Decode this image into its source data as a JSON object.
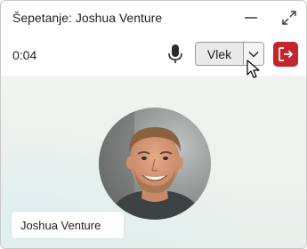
{
  "window": {
    "title": "Šepetanje: Joshua Venture"
  },
  "titlebar": {
    "minimize_icon": "minimize-icon",
    "expand_icon": "expand-icon"
  },
  "call": {
    "timer": "0:04",
    "mic_icon": "microphone-icon",
    "mode_button_label": "Vlek",
    "mode_dropdown_icon": "chevron-down-icon",
    "leave_icon": "leave-call-icon",
    "leave_color": "#c4262e"
  },
  "participant": {
    "name": "Joshua Venture",
    "avatar_icon": "avatar"
  }
}
